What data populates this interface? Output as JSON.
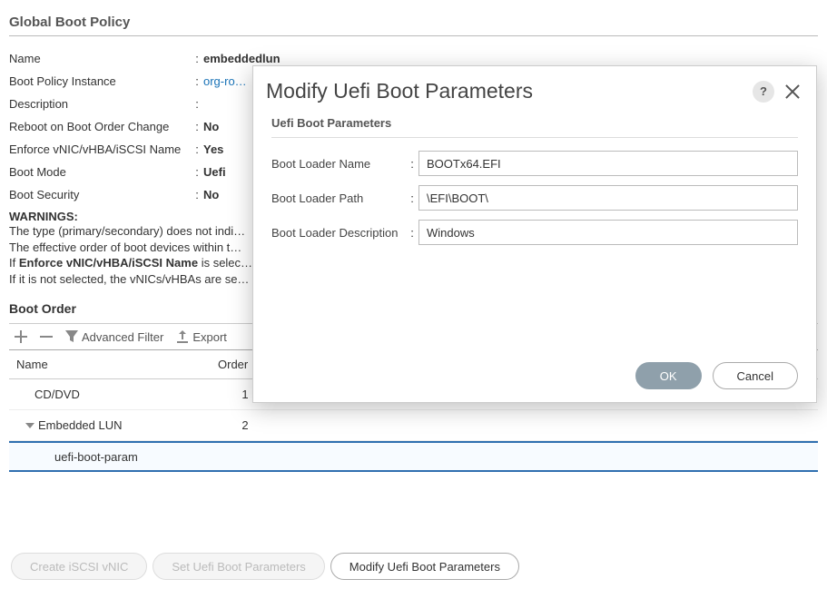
{
  "page_title": "Global Boot Policy",
  "props": {
    "name_label": "Name",
    "name_value": "embeddedlun",
    "instance_label": "Boot Policy Instance",
    "instance_value": "org-ro…",
    "desc_label": "Description",
    "desc_value": "",
    "reboot_label": "Reboot on Boot Order Change",
    "reboot_value": "No",
    "enforce_label": "Enforce vNIC/vHBA/iSCSI Name",
    "enforce_value": "Yes",
    "mode_label": "Boot Mode",
    "mode_value": "Uefi",
    "security_label": "Boot Security",
    "security_value": "No"
  },
  "warnings": {
    "head": "WARNINGS:",
    "line1": "The type (primary/secondary) does not indi…",
    "line2": "The effective order of boot devices within t…",
    "line3_a": "If ",
    "line3_b": "Enforce vNIC/vHBA/iSCSI Name",
    "line3_c": " is selec…",
    "line4": "If it is not selected, the vNICs/vHBAs are se…"
  },
  "boot_order": {
    "title": "Boot Order",
    "toolbar": {
      "filter": "Advanced Filter",
      "export": "Export"
    },
    "cols": {
      "name": "Name",
      "order": "Order"
    },
    "rows": [
      {
        "name": "CD/DVD",
        "order": "1",
        "indent": 1,
        "caret": false
      },
      {
        "name": "Embedded LUN",
        "order": "2",
        "indent": 1,
        "caret": true
      },
      {
        "name": "uefi-boot-param",
        "order": "",
        "indent": 2,
        "caret": false,
        "selected": true
      }
    ]
  },
  "bottom_buttons": {
    "b1": "Create iSCSI vNIC",
    "b2": "Set Uefi Boot Parameters",
    "b3": "Modify Uefi Boot Parameters"
  },
  "modal": {
    "title": "Modify Uefi Boot Parameters",
    "subtitle": "Uefi Boot Parameters",
    "name_label": "Boot Loader Name",
    "name_value": "BOOTx64.EFI",
    "path_label": "Boot Loader Path",
    "path_value": "\\EFI\\BOOT\\",
    "desc_label": "Boot Loader Description",
    "desc_value": "Windows",
    "ok": "OK",
    "cancel": "Cancel"
  }
}
